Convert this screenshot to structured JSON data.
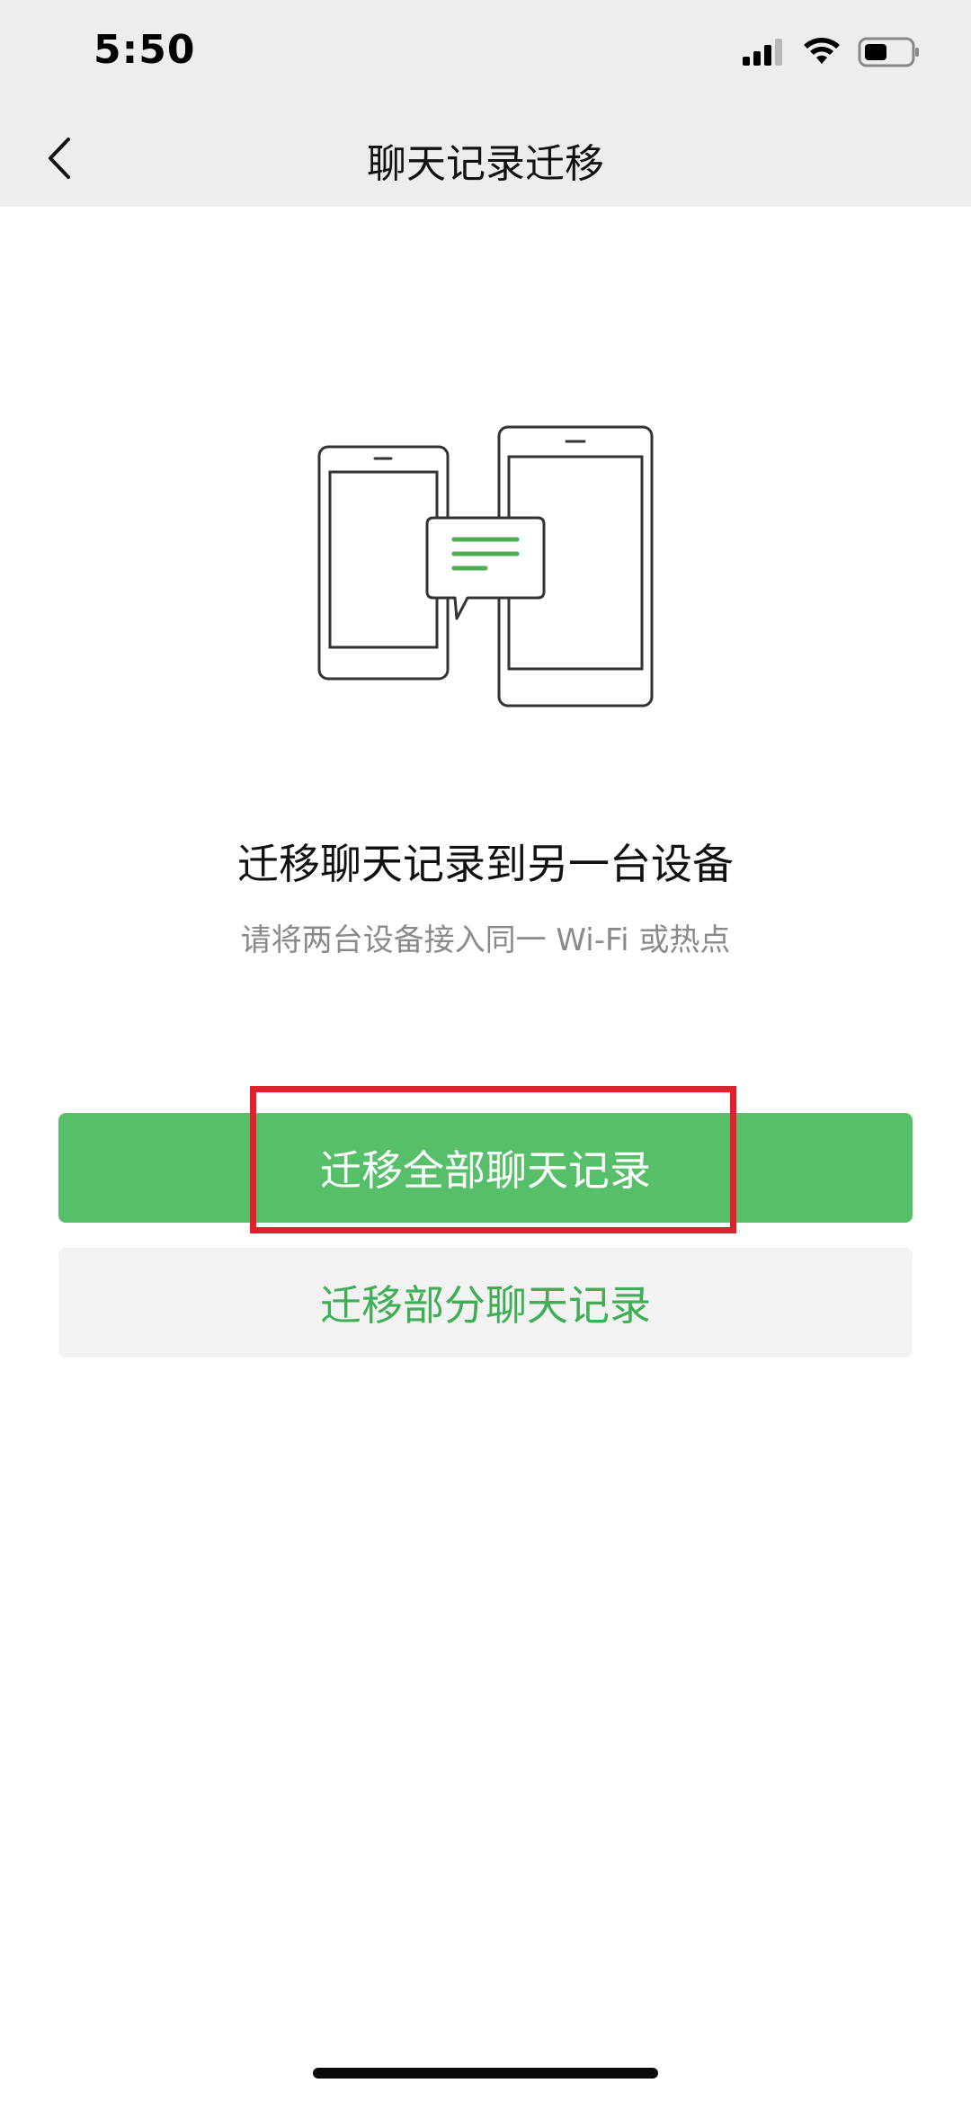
{
  "status_bar": {
    "time": "5:50"
  },
  "nav": {
    "title": "聊天记录迁移"
  },
  "content": {
    "headline": "迁移聊天记录到另一台设备",
    "subline": "请将两台设备接入同一 Wi-Fi 或热点"
  },
  "buttons": {
    "primary_label": "迁移全部聊天记录",
    "secondary_label": "迁移部分聊天记录"
  },
  "colors": {
    "primary_green": "#57bf6a",
    "secondary_text_green": "#3fae55",
    "highlight_red": "#e0202c"
  }
}
